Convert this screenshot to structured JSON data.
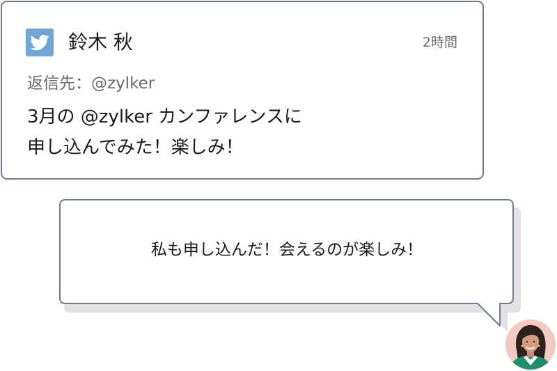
{
  "tweet": {
    "author_name": "鈴木 秋",
    "timestamp": "2時間",
    "reply_to": "返信先：@zylker",
    "text_lines": [
      "3月の @zylker カンファレンスに",
      "申し込んでみた！楽しみ！"
    ],
    "logo_icon": "twitter-bird-icon",
    "brand_color": "#6ea6d6"
  },
  "reply": {
    "text": "私も申し込んだ！会えるのが楽しみ！",
    "avatar_icon": "woman-avatar-icon"
  },
  "colors": {
    "border": "#707b91",
    "muted_text": "#6b6b6b",
    "bubble_shadow": "#e2e2e2"
  }
}
